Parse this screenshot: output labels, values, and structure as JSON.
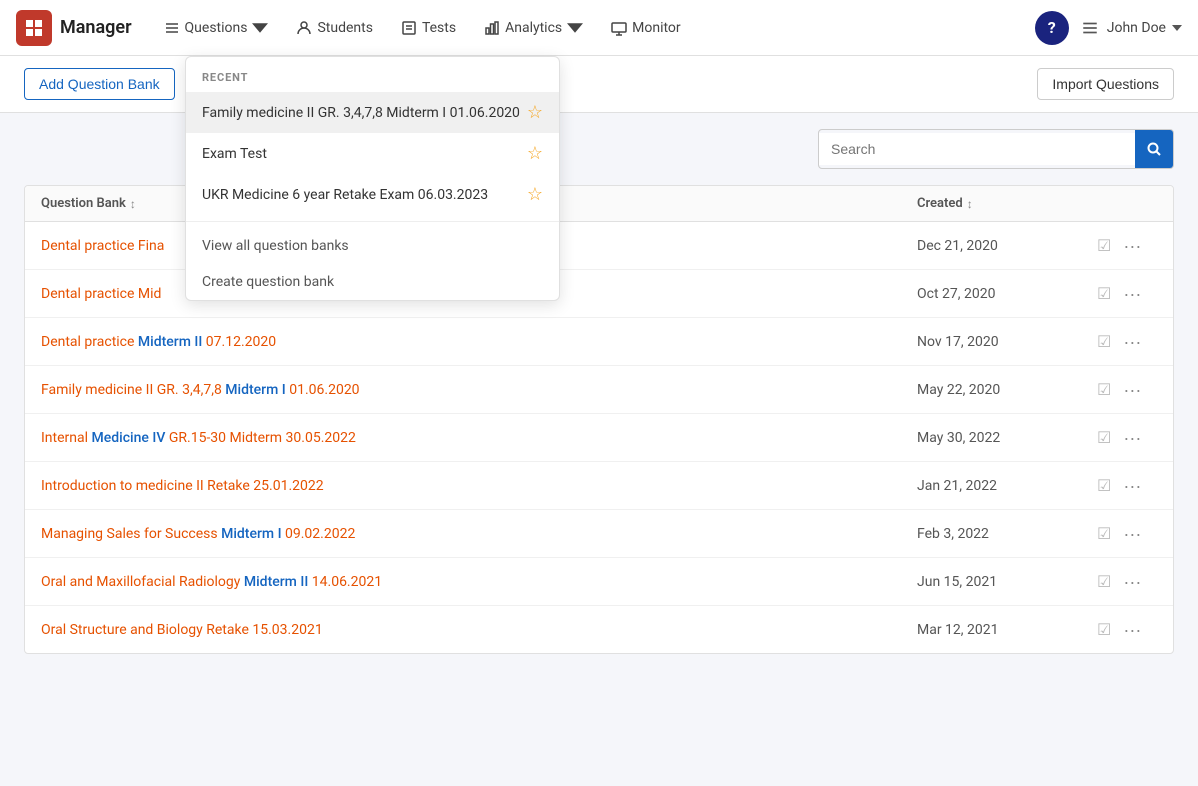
{
  "app": {
    "logo_text": "Manager",
    "logo_icon": "⊞"
  },
  "navbar": {
    "items": [
      {
        "id": "questions",
        "label": "Questions",
        "has_dropdown": true
      },
      {
        "id": "students",
        "label": "Students",
        "has_dropdown": false
      },
      {
        "id": "tests",
        "label": "Tests",
        "has_dropdown": false
      },
      {
        "id": "analytics",
        "label": "Analytics",
        "has_dropdown": true
      },
      {
        "id": "monitor",
        "label": "Monitor",
        "has_dropdown": false
      }
    ],
    "help_label": "?",
    "user_label": "John Doe"
  },
  "toolbar": {
    "add_button_label": "Add Question Bank",
    "import_button_label": "Import Questions"
  },
  "search": {
    "placeholder": "Search"
  },
  "table": {
    "column_name": "Question Bank",
    "column_created": "Created",
    "rows": [
      {
        "name": "Dental practice Fina",
        "date": "Dec 21, 2020",
        "partial": false
      },
      {
        "name": "Dental practice Mid",
        "date": "Oct 27, 2020",
        "partial": false
      },
      {
        "name_plain": "Dental practice ",
        "name_highlight": "Midterm II",
        "name_suffix": " 07.12.2020",
        "date": "Nov 17, 2020"
      },
      {
        "name_plain": "Family medicine II GR. 3,4,7,8 ",
        "name_highlight": "Midterm I",
        "name_suffix": " 01.06.2020",
        "date": "May 22, 2020"
      },
      {
        "name_plain": "Internal ",
        "name_highlight": "Medicine IV",
        "name_suffix": " GR.15-30 Midterm 30.05.2022",
        "date": "May 30, 2022"
      },
      {
        "name_plain": "Introduction to medicine II Retake 25.01.2022",
        "date": "Jan 21, 2022"
      },
      {
        "name_plain": "Managing Sales for Success ",
        "name_highlight": "Midterm I",
        "name_suffix": " 09.02.2022",
        "date": "Feb 3, 2022"
      },
      {
        "name_plain": "Oral and Maxillofacial Radiology ",
        "name_highlight": "Midterm II",
        "name_suffix": " 14.06.2021",
        "date": "Jun 15, 2021"
      },
      {
        "name_plain": "Oral Structure and Biology Retake 15.03.2021",
        "date": "Mar 12, 2021"
      }
    ]
  },
  "dropdown": {
    "section_title": "RECENT",
    "items": [
      {
        "label": "Family medicine II GR. 3,4,7,8 Midterm I 01.06.2020",
        "starred": false,
        "active": true
      },
      {
        "label": "Exam Test",
        "starred": false,
        "active": false
      },
      {
        "label": "UKR Medicine 6 year Retake Exam 06.03.2023",
        "starred": false,
        "active": false
      }
    ],
    "footer_links": [
      {
        "label": "View all question banks"
      },
      {
        "label": "Create question bank"
      }
    ]
  }
}
